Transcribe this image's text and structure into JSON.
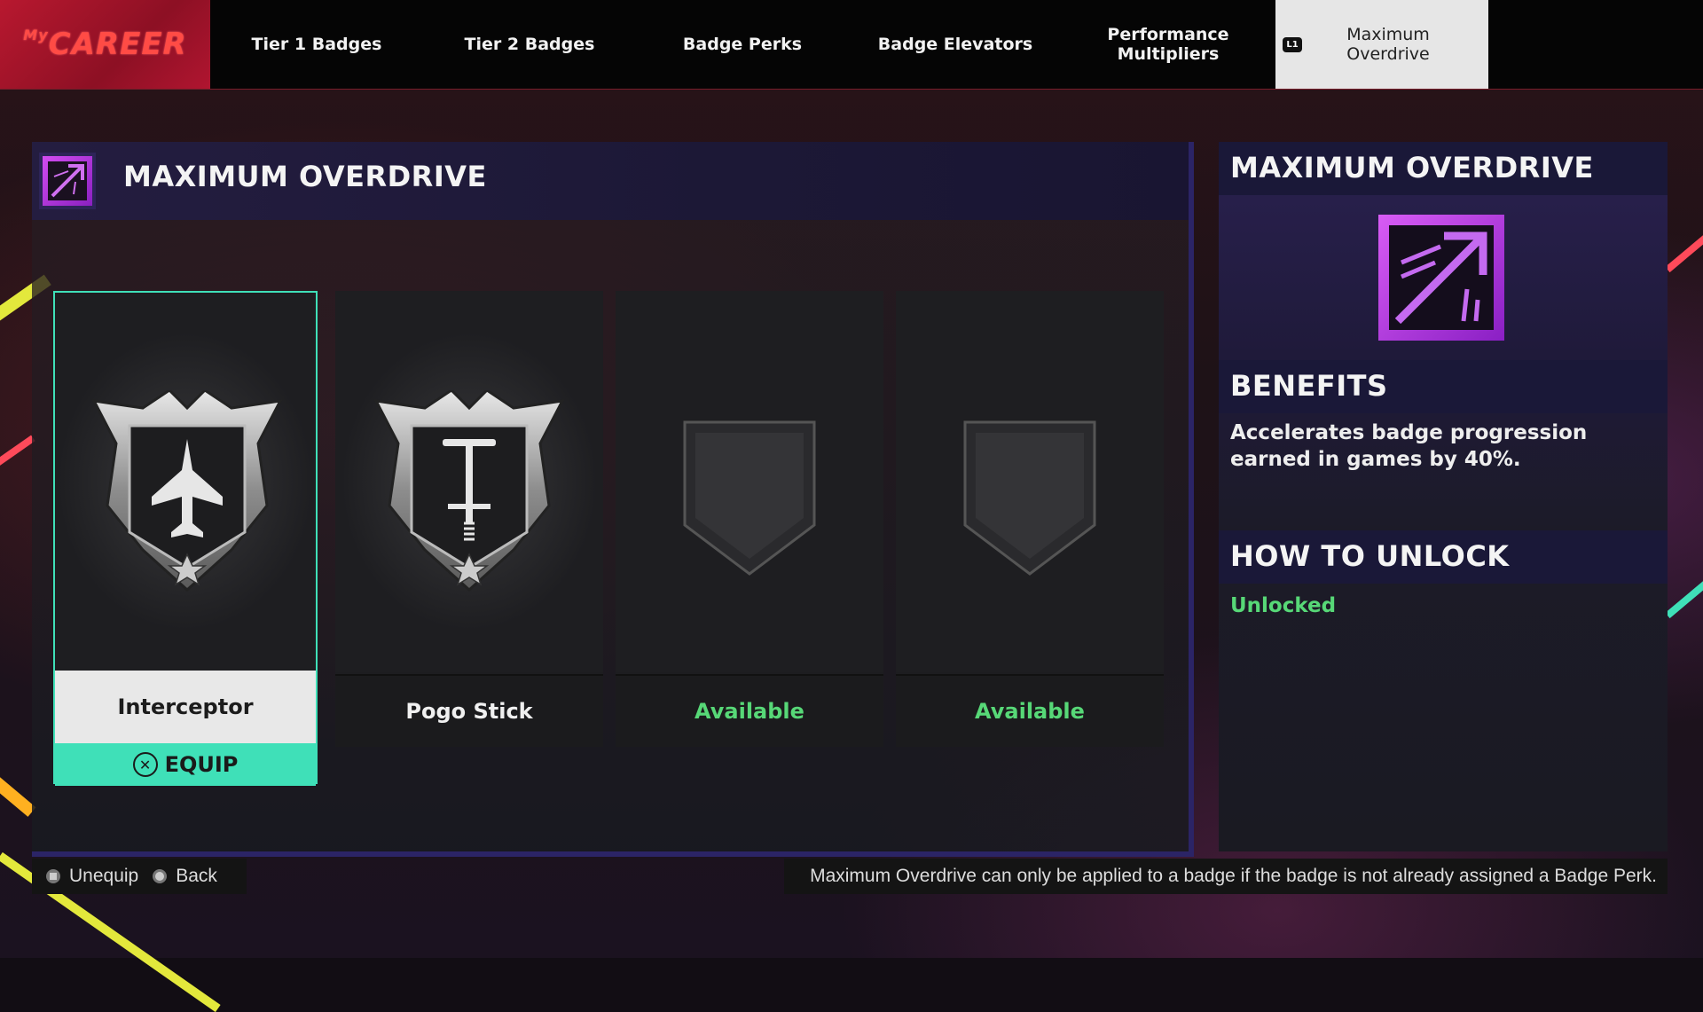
{
  "logo": {
    "text": "CAREER",
    "prefix": "My"
  },
  "nav": {
    "tabs": [
      {
        "label": "Tier 1 Badges"
      },
      {
        "label": "Tier 2 Badges"
      },
      {
        "label": "Badge Perks"
      },
      {
        "label": "Badge Elevators"
      },
      {
        "label_line1": "Performance",
        "label_line2": "Multipliers"
      },
      {
        "label_line1": "Maximum",
        "label_line2": "Overdrive",
        "active": true,
        "button_hint": "L1"
      }
    ]
  },
  "main_panel": {
    "title": "MAXIMUM OVERDRIVE",
    "icon": "maximum-overdrive-icon",
    "cards": [
      {
        "name": "Interceptor",
        "icon": "jet-badge-icon",
        "selected": true,
        "action": "EQUIP"
      },
      {
        "name": "Pogo Stick",
        "icon": "pogo-stick-badge-icon"
      },
      {
        "name": "Available",
        "icon": "empty-shield-icon"
      },
      {
        "name": "Available",
        "icon": "empty-shield-icon"
      }
    ]
  },
  "detail": {
    "title": "MAXIMUM OVERDRIVE",
    "benefits_heading": "BENEFITS",
    "benefits_text": "Accelerates badge progression earned in games by 40%.",
    "unlock_heading": "HOW TO UNLOCK",
    "unlock_status": "Unlocked"
  },
  "footer": {
    "unequip_label": "Unequip",
    "back_label": "Back",
    "hint": "Maximum Overdrive can only be applied to a badge if the badge is not already assigned a Badge Perk."
  },
  "colors": {
    "accent_teal": "#3fe0b8",
    "available_green": "#57d877",
    "panel_purple": "#2b2466",
    "logo_red": "#b8182f",
    "perk_magenta": "#b33ad8"
  }
}
